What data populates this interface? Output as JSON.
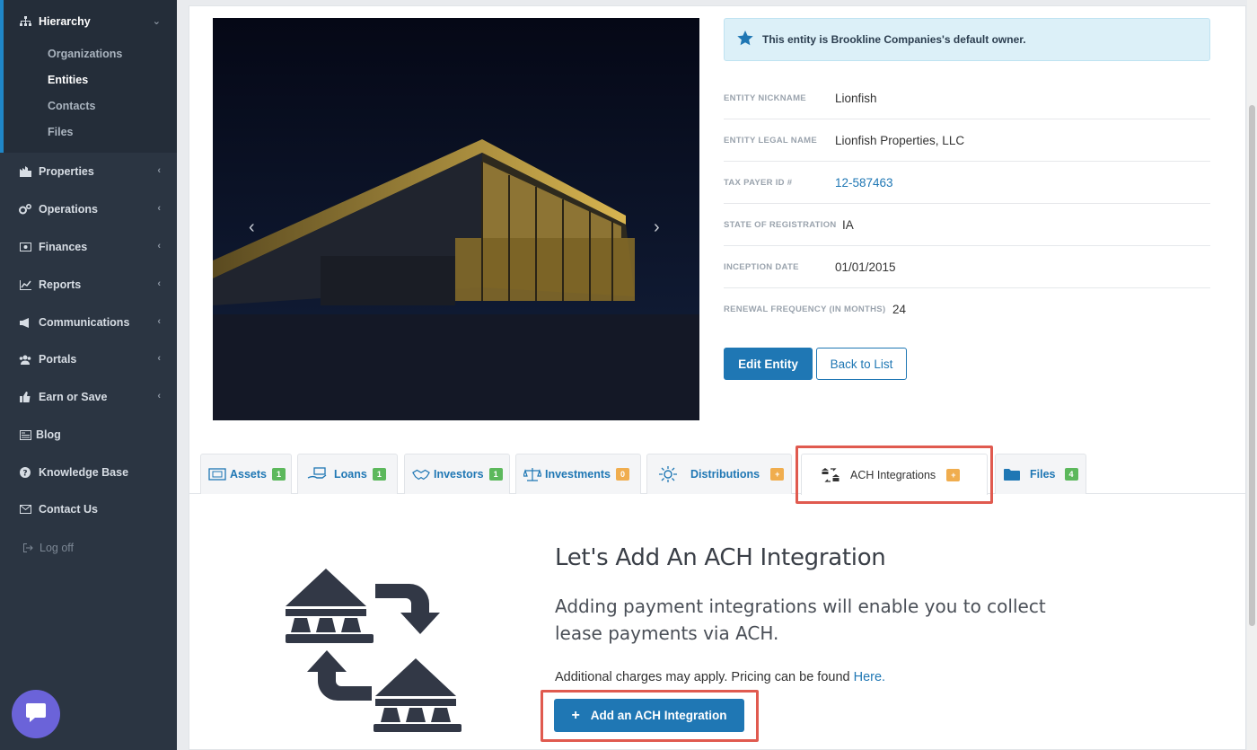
{
  "sidebar": {
    "hierarchy": "Hierarchy",
    "sub": [
      "Organizations",
      "Entities",
      "Contacts",
      "Files"
    ],
    "items": [
      "Properties",
      "Operations",
      "Finances",
      "Reports",
      "Communications",
      "Portals",
      "Earn or Save",
      "Blog",
      "Knowledge Base",
      "Contact Us"
    ],
    "logoff": "Log off"
  },
  "notice": {
    "text": "This entity is Brookline Companies's default owner."
  },
  "fields": [
    {
      "label": "ENTITY NICKNAME",
      "value": "Lionfish"
    },
    {
      "label": "ENTITY LEGAL NAME",
      "value": "Lionfish Properties, LLC"
    },
    {
      "label": "TAX PAYER ID #",
      "value": "12-587463"
    },
    {
      "label": "STATE OF REGISTRATION",
      "value": "IA"
    },
    {
      "label": "INCEPTION DATE",
      "value": "01/01/2015"
    },
    {
      "label": "RENEWAL FREQUENCY (IN MONTHS)",
      "value": "24"
    }
  ],
  "buttons": {
    "edit": "Edit Entity",
    "back": "Back to List"
  },
  "tabs": [
    {
      "label": "Assets",
      "badge": "1"
    },
    {
      "label": "Loans",
      "badge": "1"
    },
    {
      "label": "Investors",
      "badge": "1"
    },
    {
      "label": "Investments",
      "badge": "0"
    },
    {
      "label": "Distributions",
      "badge": "+"
    },
    {
      "label": "ACH Integrations",
      "badge": "+"
    },
    {
      "label": "Files",
      "badge": "4"
    }
  ],
  "empty_state": {
    "title": "Let's Add An ACH Integration",
    "description": "Adding payment integrations will enable you to collect lease payments via ACH.",
    "note": "Additional charges may apply. Pricing can be found",
    "note_link": "Here.",
    "button": "Add an ACH Integration"
  },
  "colors": {
    "accent": "#1f77b4",
    "highlight": "#e05a4f",
    "sidebar": "#2b3542"
  }
}
